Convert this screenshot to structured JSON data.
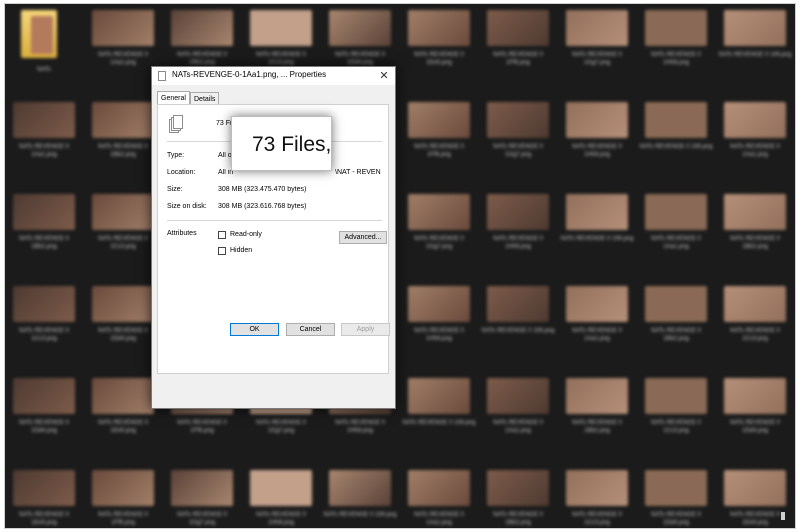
{
  "background": {
    "folder_label": "NATs",
    "file_labels": [
      "NATs REVENGE 0 1Aa1.png",
      "NATs REVENGE 0 1Bb2.png",
      "NATs REVENGE 0 1Cc3.png",
      "NATs REVENGE 0 1Dd4.png",
      "NATs REVENGE 0 1Ee5.png",
      "NATs REVENGE 0 1Ff6.png",
      "NATs REVENGE 0 1Gg7.png",
      "NATs REVENGE 0 1Hh8.png",
      "NATs REVENGE 0 1Ii9.png"
    ],
    "thumb_colors": [
      "#6b4a3c",
      "#8a6a56",
      "#a07e68",
      "#5a4238",
      "#b58f78",
      "#7d5b4a",
      "#c2a08a",
      "#4e3a31",
      "#93705c",
      "#a8866f"
    ]
  },
  "dialog": {
    "title": "NATs-REVENGE-0-1Aa1.png, ... Properties",
    "close_glyph": "✕",
    "tabs": [
      {
        "label": "General"
      },
      {
        "label": "Details"
      }
    ],
    "summary_text": "73 Fi",
    "rows": {
      "type_label": "Type:",
      "type_value": "All o",
      "location_label": "Location:",
      "location_value": "All in",
      "location_value_end": "\\NAT - REVEN",
      "size_label": "Size:",
      "size_value": "308 MB (323.475.470 bytes)",
      "size_on_disk_label": "Size on disk:",
      "size_on_disk_value": "308 MB (323.616.768 bytes)"
    },
    "attributes_label": "Attributes",
    "readonly_label": "Read-only",
    "hidden_label": "Hidden",
    "readonly_checked": false,
    "hidden_checked": false,
    "advanced_label": "Advanced...",
    "ok_label": "OK",
    "cancel_label": "Cancel",
    "apply_label": "Apply",
    "accent_color": "#0078d7"
  },
  "zoom_callout": {
    "text": "73 Files,"
  }
}
